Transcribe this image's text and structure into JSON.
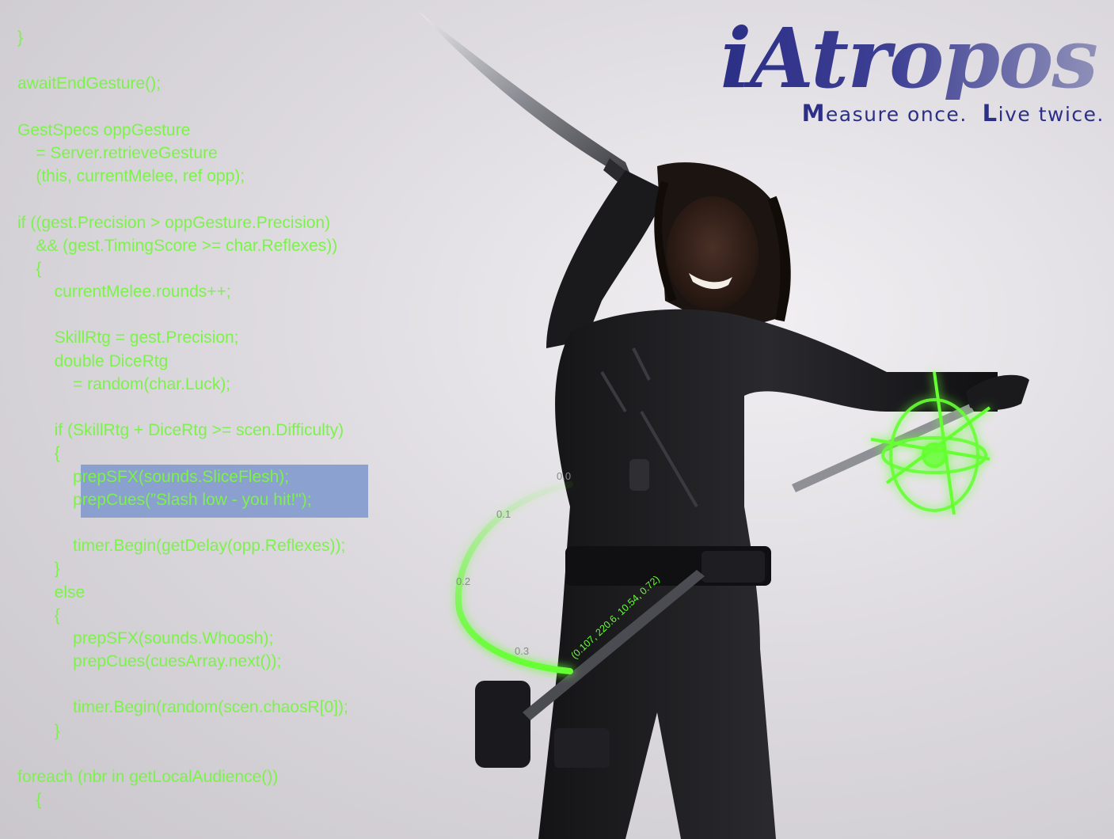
{
  "logo": {
    "wordmark": "iAtropos",
    "tagline_part1_cap": "M",
    "tagline_part1_rest": "easure once.",
    "tagline_part2_cap": "L",
    "tagline_part2_rest": "ive twice."
  },
  "code_lines": [
    "}",
    "",
    "awaitEndGesture();",
    "",
    "GestSpecs oppGesture",
    "    = Server.retrieveGesture",
    "    (this, currentMelee, ref opp);",
    "",
    "if ((gest.Precision > oppGesture.Precision)",
    "    && (gest.TimingScore >= char.Reflexes))",
    "    {",
    "        currentMelee.rounds++;",
    "",
    "        SkillRtg = gest.Precision;",
    "        double DiceRtg",
    "            = random(char.Luck);",
    "",
    "        if (SkillRtg + DiceRtg >= scen.Difficulty)",
    "        {",
    "            prepSFX(sounds.SliceFlesh);",
    "            prepCues(”Slash low - you hit!\");",
    "",
    "            timer.Begin(getDelay(opp.Reflexes));",
    "        }",
    "        else",
    "        {",
    "            prepSFX(sounds.Whoosh);",
    "            prepCues(cuesArray.next());",
    "",
    "            timer.Begin(random(scen.chaosR[0]);",
    "        }",
    "",
    "foreach (nbr in getLocalAudience())",
    "    {"
  ],
  "hud": {
    "arc_labels": [
      "0.0",
      "0.1",
      "0.2",
      "0.3"
    ],
    "vector_readout": "(0.107, 220.6, 10.54, 0.72)",
    "accent_color": "#66ff33"
  },
  "colors": {
    "code_text": "#7cf24a",
    "highlight": "#8fa6d2",
    "logo_blue": "#2c2f86"
  }
}
